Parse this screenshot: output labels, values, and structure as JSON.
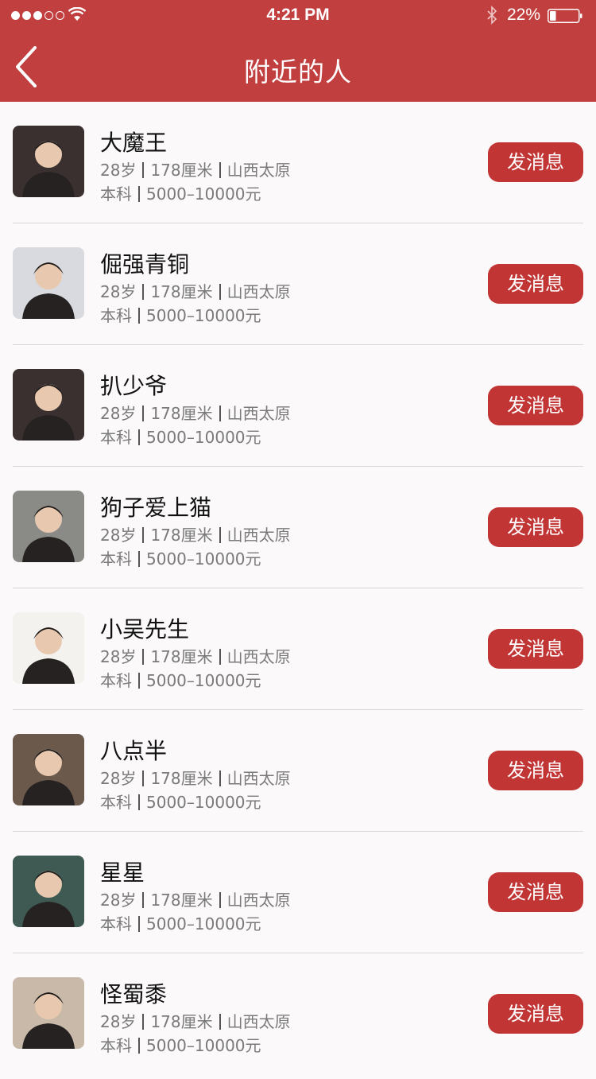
{
  "status_bar": {
    "time": "4:21 PM",
    "battery_percent": "22%",
    "battery_level": 0.22,
    "signal_bars_filled": 3,
    "signal_bars_total": 5
  },
  "nav": {
    "title": "附近的人"
  },
  "colors": {
    "header_bg": "#c23f3f",
    "button_bg": "#c23535",
    "page_bg": "#fbf9f9"
  },
  "people": [
    {
      "name": "大魔王",
      "age": "28岁",
      "height": "178厘米",
      "location": "山西太原",
      "education": "本科",
      "income": "5000–10000元",
      "action": "发消息",
      "avatar_bg": "#3a3030"
    },
    {
      "name": "倔强青铜",
      "age": "28岁",
      "height": "178厘米",
      "location": "山西太原",
      "education": "本科",
      "income": "5000–10000元",
      "action": "发消息",
      "avatar_bg": "#d9dadf"
    },
    {
      "name": "扒少爷",
      "age": "28岁",
      "height": "178厘米",
      "location": "山西太原",
      "education": "本科",
      "income": "5000–10000元",
      "action": "发消息",
      "avatar_bg": "#3a3030"
    },
    {
      "name": "狗子爱上猫",
      "age": "28岁",
      "height": "178厘米",
      "location": "山西太原",
      "education": "本科",
      "income": "5000–10000元",
      "action": "发消息",
      "avatar_bg": "#8a8a86"
    },
    {
      "name": "小吴先生",
      "age": "28岁",
      "height": "178厘米",
      "location": "山西太原",
      "education": "本科",
      "income": "5000–10000元",
      "action": "发消息",
      "avatar_bg": "#f4f2ee"
    },
    {
      "name": "八点半",
      "age": "28岁",
      "height": "178厘米",
      "location": "山西太原",
      "education": "本科",
      "income": "5000–10000元",
      "action": "发消息",
      "avatar_bg": "#6b5a4c"
    },
    {
      "name": "星星",
      "age": "28岁",
      "height": "178厘米",
      "location": "山西太原",
      "education": "本科",
      "income": "5000–10000元",
      "action": "发消息",
      "avatar_bg": "#3e5a52"
    },
    {
      "name": "怪蜀黍",
      "age": "28岁",
      "height": "178厘米",
      "location": "山西太原",
      "education": "本科",
      "income": "5000–10000元",
      "action": "发消息",
      "avatar_bg": "#c9b9a9"
    }
  ]
}
